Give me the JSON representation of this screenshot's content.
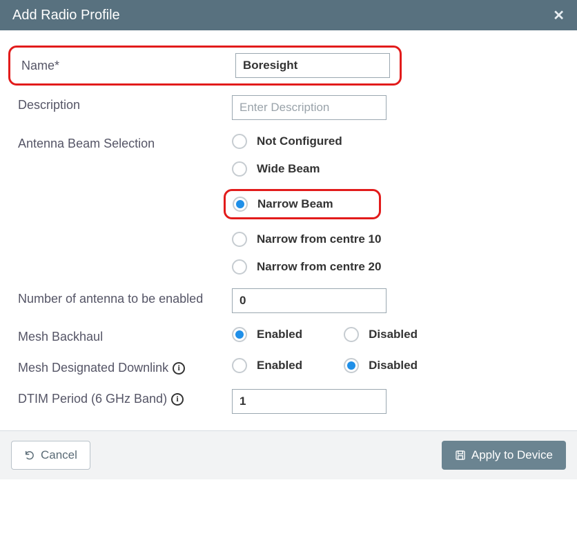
{
  "header": {
    "title": "Add Radio Profile"
  },
  "fields": {
    "name": {
      "label": "Name*",
      "value": "Boresight"
    },
    "description": {
      "label": "Description",
      "placeholder": "Enter Description",
      "value": ""
    },
    "beam": {
      "label": "Antenna Beam Selection",
      "options": {
        "not_configured": "Not Configured",
        "wide": "Wide Beam",
        "narrow": "Narrow Beam",
        "narrow10": "Narrow from centre 10",
        "narrow20": "Narrow from centre 20"
      }
    },
    "antenna_count": {
      "label": "Number of antenna to be enabled",
      "value": "0"
    },
    "mesh_backhaul": {
      "label": "Mesh Backhaul",
      "enabled": "Enabled",
      "disabled": "Disabled"
    },
    "mesh_downlink": {
      "label": "Mesh Designated Downlink",
      "enabled": "Enabled",
      "disabled": "Disabled"
    },
    "dtim": {
      "label": "DTIM Period (6 GHz Band)",
      "value": "1"
    }
  },
  "footer": {
    "cancel": "Cancel",
    "apply": "Apply to Device"
  }
}
